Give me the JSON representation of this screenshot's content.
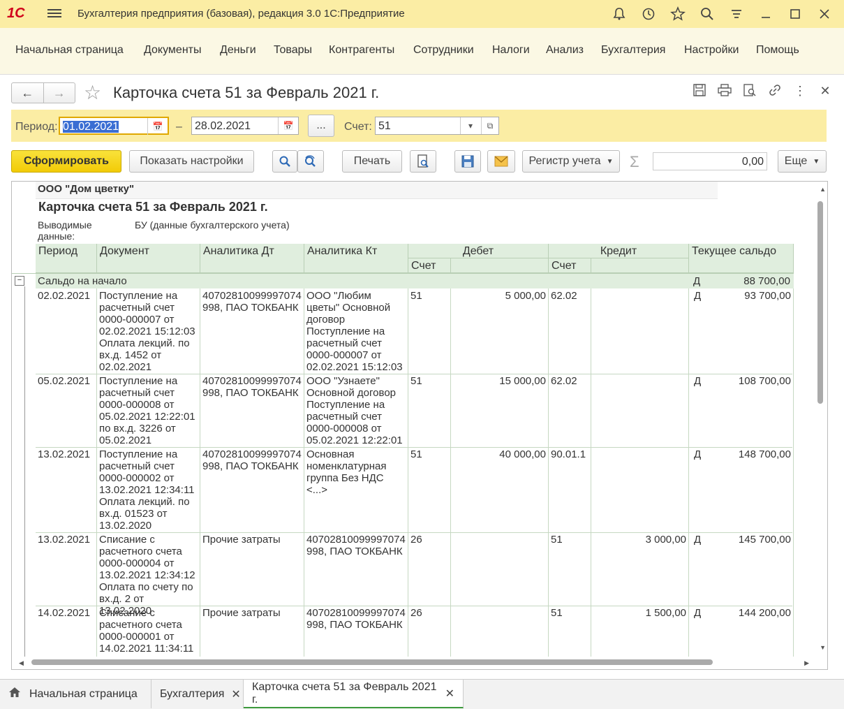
{
  "app": {
    "logo": "1С",
    "title": "Бухгалтерия предприятия (базовая), редакция 3.0 1С:Предприятие"
  },
  "titlebar_icons": [
    "bell-icon",
    "history-icon",
    "star-icon",
    "search-icon",
    "settings-icon",
    "minimize-icon",
    "maximize-icon",
    "close-icon"
  ],
  "sections": [
    "Начальная страница",
    "Документы",
    "Деньги",
    "Товары",
    "Контрагенты",
    "Сотрудники",
    "Налоги",
    "Анализ",
    "Бухгалтерия",
    "Настройки",
    "Помощь"
  ],
  "form": {
    "title": "Карточка счета 51 за Февраль 2021 г."
  },
  "period": {
    "label": "Период:",
    "from": "01.02.2021",
    "dash": "–",
    "to": "28.02.2021",
    "dots": "...",
    "account_label": "Счет:",
    "account": "51"
  },
  "toolbar": {
    "generate": "Сформировать",
    "settings": "Показать настройки",
    "print": "Печать",
    "register": "Регистр учета",
    "sum_value": "0,00",
    "more": "Еще"
  },
  "report": {
    "org": "ООО \"Дом цветку\"",
    "title": "Карточка счета 51 за Февраль 2021 г.",
    "output_label": "Выводимые данные:",
    "output_value": "БУ (данные бухгалтерского учета)",
    "headers": {
      "period": "Период",
      "document": "Документ",
      "an_dt": "Аналитика Дт",
      "an_kt": "Аналитика Кт",
      "debit": "Дебет",
      "credit": "Кредит",
      "balance": "Текущее сальдо",
      "account": "Счет"
    },
    "opening": {
      "label": "Сальдо на начало",
      "side": "Д",
      "value": "88 700,00"
    },
    "rows": [
      {
        "date": "02.02.2021",
        "doc": "Поступление на расчетный счет 0000-000007 от 02.02.2021 15:12:03 Оплата лекций. по вх.д. 1452 от 02.02.2021",
        "an_dt": "40702810099997074 998, ПАО ТОКБАНК",
        "an_kt": "ООО \"Любим цветы\" Основной договор Поступление на расчетный счет 0000-000007 от 02.02.2021 15:12:03",
        "dt_acc": "51",
        "dt_sum": "5 000,00",
        "kt_acc": "62.02",
        "kt_sum": "",
        "side": "Д",
        "balance": "93 700,00"
      },
      {
        "date": "05.02.2021",
        "doc": "Поступление на расчетный счет 0000-000008 от 05.02.2021 12:22:01  по вх.д. 3226 от 05.02.2021",
        "an_dt": "40702810099997074 998, ПАО ТОКБАНК",
        "an_kt": "ООО \"Узнаете\" Основной договор Поступление на расчетный счет 0000-000008 от 05.02.2021 12:22:01",
        "dt_acc": "51",
        "dt_sum": "15 000,00",
        "kt_acc": "62.02",
        "kt_sum": "",
        "side": "Д",
        "balance": "108 700,00"
      },
      {
        "date": "13.02.2021",
        "doc": "Поступление на расчетный счет 0000-000002 от 13.02.2021 12:34:11 Оплата лекций. по вх.д. 01523 от 13.02.2020",
        "an_dt": "40702810099997074 998, ПАО ТОКБАНК",
        "an_kt": "Основная номенклатурная группа Без НДС <...>",
        "dt_acc": "51",
        "dt_sum": "40 000,00",
        "kt_acc": "90.01.1",
        "kt_sum": "",
        "side": "Д",
        "balance": "148 700,00"
      },
      {
        "date": "13.02.2021",
        "doc": "Списание с расчетного счета 0000-000004 от 13.02.2021 12:34:12 Оплата по счету по вх.д. 2 от 13.02.2020",
        "an_dt": "Прочие затраты",
        "an_kt": "40702810099997074 998, ПАО ТОКБАНК",
        "dt_acc": "26",
        "dt_sum": "",
        "kt_acc": "51",
        "kt_sum": "3 000,00",
        "side": "Д",
        "balance": "145 700,00"
      },
      {
        "date": "14.02.2021",
        "doc": "Списание с расчетного счета 0000-000001 от 14.02.2021 11:34:11",
        "an_dt": "Прочие затраты",
        "an_kt": "40702810099997074 998, ПАО ТОКБАНК",
        "dt_acc": "26",
        "dt_sum": "",
        "kt_acc": "51",
        "kt_sum": "1 500,00",
        "side": "Д",
        "balance": "144 200,00"
      }
    ]
  },
  "tabs": [
    {
      "label": "Начальная страница"
    },
    {
      "label": "Бухгалтерия"
    },
    {
      "label": "Карточка счета 51 за Февраль 2021 г."
    }
  ],
  "colors": {
    "accent_yellow": "#fbeda4",
    "primary_button": "#f2cb06",
    "table_header": "#e0eede",
    "selection": "#3a6ed3"
  }
}
